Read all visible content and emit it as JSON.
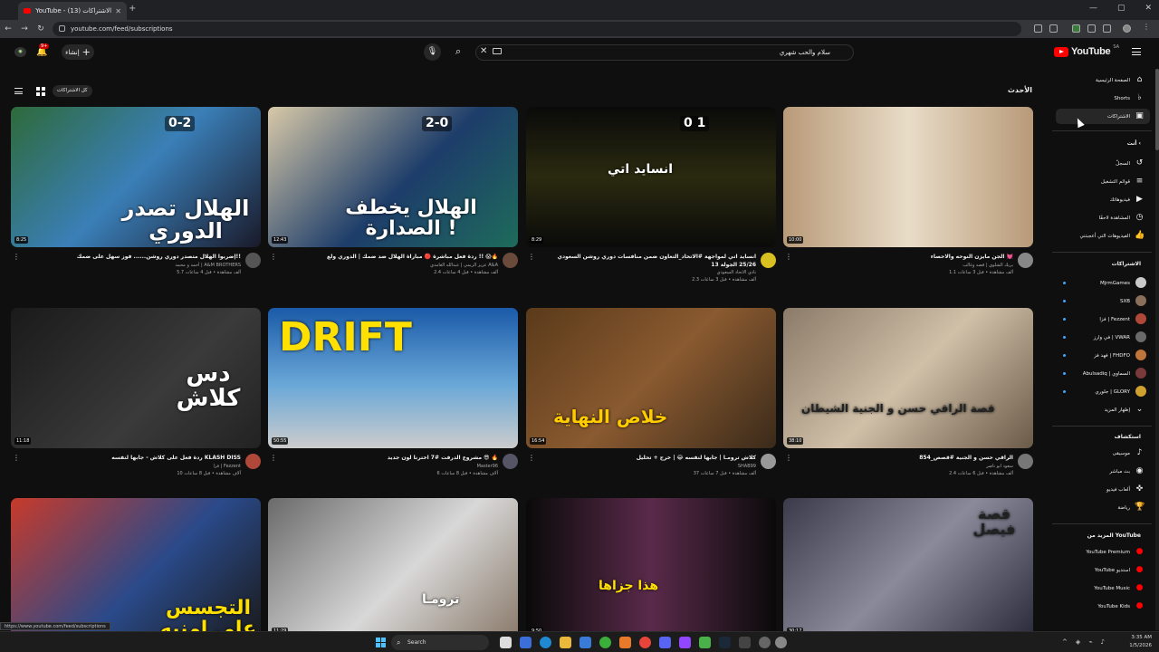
{
  "browser": {
    "tab_title": "YouTube - الاشتراكات (13)",
    "url": "youtube.com/feed/subscriptions",
    "status_url": "https://www.youtube.com/feed/subscriptions"
  },
  "header": {
    "logo_text": "YouTube",
    "region": "SA",
    "search_value": "سلام والحب شهري",
    "create_label": "إنشاء",
    "notification_count": "9+"
  },
  "content": {
    "title": "الأحدث",
    "all_label": "كل الاشتراكات"
  },
  "sidebar": {
    "nav": [
      {
        "label": "الصفحة الرئيسية",
        "icon": "home-icon",
        "glyph": "⌂"
      },
      {
        "label": "Shorts",
        "icon": "shorts-icon",
        "glyph": "♭"
      },
      {
        "label": "الاشتراكات",
        "icon": "subscriptions-icon",
        "glyph": "▣"
      }
    ],
    "you_heading": "أنت",
    "you_items": [
      {
        "label": "السجلّ",
        "icon": "history-icon",
        "glyph": "↺"
      },
      {
        "label": "قوائم التشغيل",
        "icon": "playlists-icon",
        "glyph": "≡"
      },
      {
        "label": "فيديوهاتك",
        "icon": "your-videos-icon",
        "glyph": "▶"
      },
      {
        "label": "المشاهدة لاحقًا",
        "icon": "watch-later-icon",
        "glyph": "◷"
      },
      {
        "label": "الفيديوهات التي أعجبتني",
        "icon": "liked-icon",
        "glyph": "👍"
      }
    ],
    "subs_heading": "الاشتراكات",
    "subscriptions": [
      {
        "label": "MjrmGames",
        "color": "#c9c9c9"
      },
      {
        "label": "SXB",
        "color": "#8a6f5a"
      },
      {
        "label": "فزا | Fezzent",
        "color": "#b0483a"
      },
      {
        "label": "في وارز | VWAR",
        "color": "#6a6a6a"
      },
      {
        "label": "فهد فز | FHDFO",
        "color": "#c0763a"
      },
      {
        "label": "Abulsadiq | السماوي",
        "color": "#7a3a3a"
      },
      {
        "label": "جلوري | GLORY",
        "color": "#d0a030"
      }
    ],
    "show_more": "إظهار المزيد",
    "explore_heading": "استكشاف",
    "explore_items": [
      {
        "label": "موسيقى",
        "icon": "music-icon",
        "glyph": "♪"
      },
      {
        "label": "بث مباشر",
        "icon": "live-icon",
        "glyph": "◉"
      },
      {
        "label": "ألعاب فيديو",
        "icon": "gaming-icon",
        "glyph": "✜"
      },
      {
        "label": "رياضة",
        "icon": "sports-icon",
        "glyph": "🏆"
      }
    ],
    "more_heading": "المزيد من YouTube",
    "more_items": [
      {
        "label": "YouTube Premium"
      },
      {
        "label": "YouTube استديو"
      },
      {
        "label": "YouTube Music"
      },
      {
        "label": "YouTube Kids"
      }
    ]
  },
  "videos": [
    {
      "title": "إضربوا الهلال متصدر دوري روشن...... فوز سهل على ضمك!!",
      "channel": "أحمد و محمد | A&M BROTHERS",
      "stats": "5.7 ألف مشاهدة • قبل 4 ساعات",
      "duration": "8:25",
      "thumb_text": "الهلال تصدر الدوري",
      "score": "0-2",
      "bg": "linear-gradient(135deg,#2e6a3a,#3a7fb8 50%,#1a1a2a)",
      "av": "#555"
    },
    {
      "title": "ردة فعل مباشرة 🔴 مباراة الهلال ضد ضمك | الدوري ولع !! 😱🔥",
      "channel": "عزيز الريمي | عبدالله الغامدي A&A",
      "stats": "2.4 ألف مشاهدة • قبل 4 ساعات",
      "duration": "12:43",
      "thumb_text": "الهلال يخطف الصدارة !",
      "score": "2-0",
      "bg": "linear-gradient(135deg,#d8c9a8,#1d3d6a 55%,#1e6b5b)",
      "av": "#6a4a3a"
    },
    {
      "title": "انسايد اتي لمواجهة #الاتحاد_التعاون ضمن منافسات دوري روشن السعودي 25/26 الجولة 13",
      "channel": "نادي الاتحاد السعودي",
      "stats": "2.3 ألف مشاهدة • قبل 3 ساعات",
      "duration": "8:29",
      "thumb_text": "انسايد اتي",
      "score": "0 1",
      "bg": "linear-gradient(180deg,#0a0a0a,#2a2a10 50%,#0a0a0a)",
      "av": "#d8c020"
    },
    {
      "title": "الجن مايزن النوحه والاحصاء 💓",
      "channel": "بريك الشلوي | قصه وغالب",
      "stats": "1.1 ألف مشاهدة • قبل 3 ساعات",
      "duration": "10:00",
      "thumb_text": "",
      "score": "",
      "bg": "linear-gradient(90deg,#b89a78,#e8dcc8 50%,#b89a78)",
      "av": "#888"
    },
    {
      "title": "ردة فعل على كلاش - جابها لنفسه KLASH DISS",
      "channel": "فزا | Fezzent",
      "stats": "10 آلاف مشاهدة • قبل 8 ساعات",
      "duration": "11:18",
      "thumb_text": "دس كلاش",
      "score": "",
      "bg": "linear-gradient(135deg,#1a1a1a,#3a3a3a 60%,#222)",
      "av": "#b0483a"
    },
    {
      "title": "مشروع الدرفت #7 اخترنا لون جديد 😎 🔥",
      "channel": "Master96",
      "stats": "6 آلاف مشاهدة • قبل 8 ساعات",
      "duration": "50:55",
      "thumb_text": "DRIFT",
      "score": "",
      "bg": "linear-gradient(180deg,#1a5aa8,#6aa8d8 55%,#ccc)",
      "av": "#556"
    },
    {
      "title": "كلاش ترومـا | جابها لنفسه 😂 | خرج + تحليل",
      "channel": "SHAB99",
      "stats": "37 ألف مشاهدة • قبل 7 ساعات",
      "duration": "16:54",
      "thumb_text": "خلاص النهاية",
      "score": "",
      "bg": "linear-gradient(135deg,#5a3a1a,#8a5a30 50%,#3a2a1a)",
      "av": "#999"
    },
    {
      "title": "854_الراقي حسن و الجنية #قصص",
      "channel": "سعود ابو ناصر",
      "stats": "2.4 ألف مشاهدة • قبل 6 ساعات",
      "duration": "38:10",
      "thumb_text": "قصة الراقي حسن و الجنية الشيطان",
      "score": "",
      "bg": "linear-gradient(135deg,#8a7a68,#d0c0a8 50%,#6a5a48)",
      "av": "#777"
    },
    {
      "title": "",
      "channel": "",
      "stats": "",
      "duration": "",
      "thumb_text": "التجسس على امنيه",
      "score": "",
      "bg": "linear-gradient(135deg,#c83a2a,#2a4a8a 55%,#1a1a1a)",
      "av": "#444"
    },
    {
      "title": "",
      "channel": "",
      "stats": "",
      "duration": "11:29",
      "thumb_text": "ترومـا",
      "score": "",
      "bg": "linear-gradient(135deg,#6a6a6a,#d8d8d8 55%,#8a7a6a)",
      "av": "#444"
    },
    {
      "title": "",
      "channel": "",
      "stats": "",
      "duration": "9:50",
      "thumb_text": "هذا جزاها",
      "score": "",
      "bg": "linear-gradient(90deg,#0a0a0a,#5a2a4a 50%,#0a0a0a)",
      "av": "#444"
    },
    {
      "title": "",
      "channel": "",
      "stats": "",
      "duration": "30:17",
      "thumb_text": "قصة فيصل",
      "score": "",
      "bg": "linear-gradient(135deg,#3a3a4a,#8a8a9a 50%,#2a2a3a)",
      "av": "#444"
    }
  ],
  "taskbar": {
    "search_label": "Search",
    "time": "3:35 AM",
    "date": "1/5/2026"
  },
  "colors": {
    "accent": "#ff0000",
    "bg": "#0f0f0f",
    "sub_dot": "#3ea6ff"
  }
}
